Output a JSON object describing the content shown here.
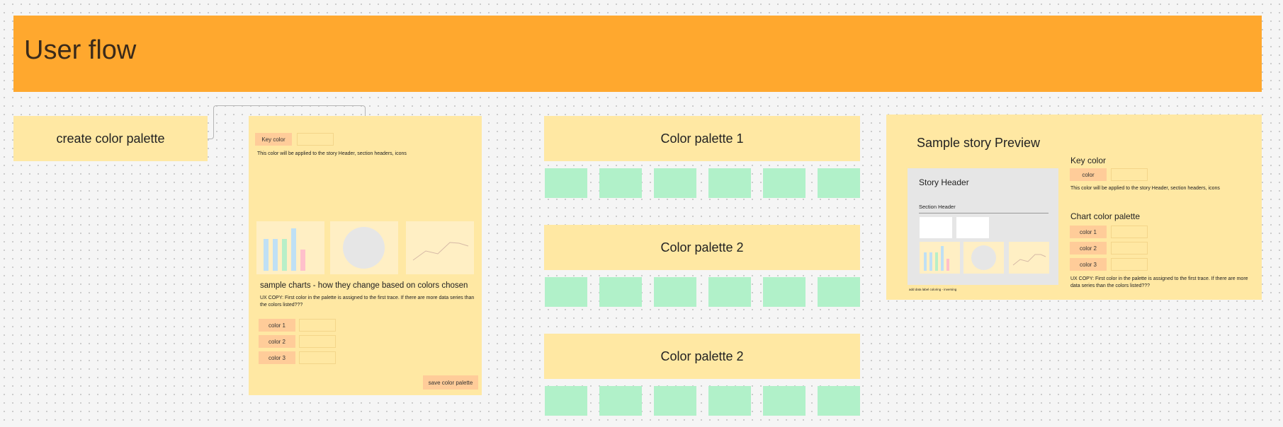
{
  "header": {
    "title": "User flow"
  },
  "create_palette": {
    "label": "create color palette"
  },
  "editor": {
    "key_color_label": "Key color",
    "key_color_desc": "This color will be applied to the story Header, section headers, icons",
    "charts_title": "sample charts - how they change based on colors chosen",
    "ux_copy": "UX COPY: First color in the palette is assigned to the first trace. If there are more data series than the colors listed???",
    "colors": [
      "color 1",
      "color 2",
      "color 3"
    ],
    "save_label": "save color palette"
  },
  "palettes": [
    {
      "title": "Color palette 1"
    },
    {
      "title": "Color palette 2"
    },
    {
      "title": "Color palette 2"
    }
  ],
  "preview": {
    "title": "Sample story Preview",
    "story_header": "Story Header",
    "section_header": "Section Header",
    "footnote": "add data label coloring - inversing",
    "key_color_title": "Key color",
    "color_btn": "color",
    "key_color_desc": "This color will be applied to the story Header, section headers, icons",
    "chart_palette_title": "Chart color palette",
    "colors": [
      "color 1",
      "color 2",
      "color 3"
    ],
    "ux_copy": "UX COPY: First color in the palette is assigned to the first trace. If there are more data series than the colors listed???"
  },
  "colors": {
    "banner": "#ffa82e",
    "sticky": "#ffe8a3",
    "swatch": "#b1f1c9",
    "button": "#ffcc99",
    "bar_blue": "#bfe0f5",
    "bar_green": "#b8efc8",
    "bar_pink": "#ffc0cb",
    "preview_bg": "#e6e6e6"
  }
}
